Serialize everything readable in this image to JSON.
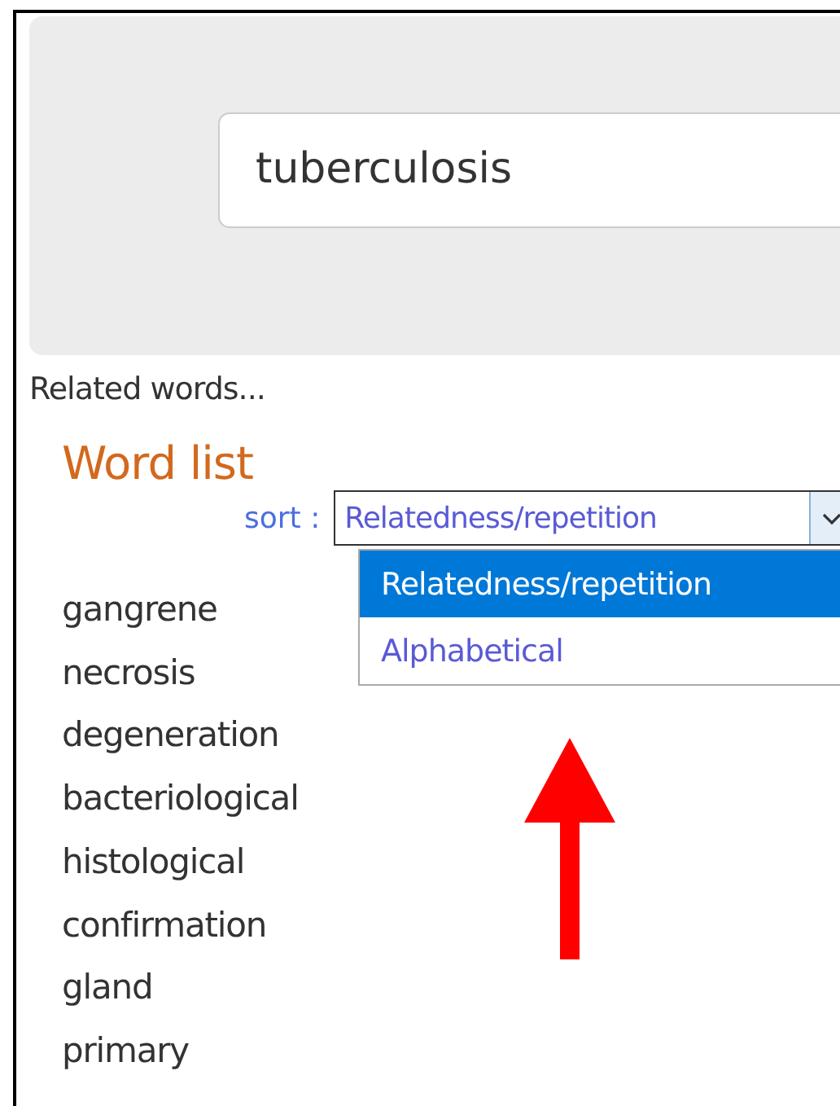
{
  "search": {
    "value": "tuberculosis"
  },
  "related_label": "Related words...",
  "word_list": {
    "title": "Word list",
    "sort_label": "sort :",
    "sort_value": "Relatedness/repetition",
    "sort_options": [
      {
        "label": "Relatedness/repetition",
        "selected": true
      },
      {
        "label": "Alphabetical",
        "selected": false
      }
    ],
    "words": [
      "gangrene",
      "necrosis",
      "degeneration",
      "bacteriological",
      "histological",
      "confirmation",
      "gland",
      "primary"
    ]
  }
}
